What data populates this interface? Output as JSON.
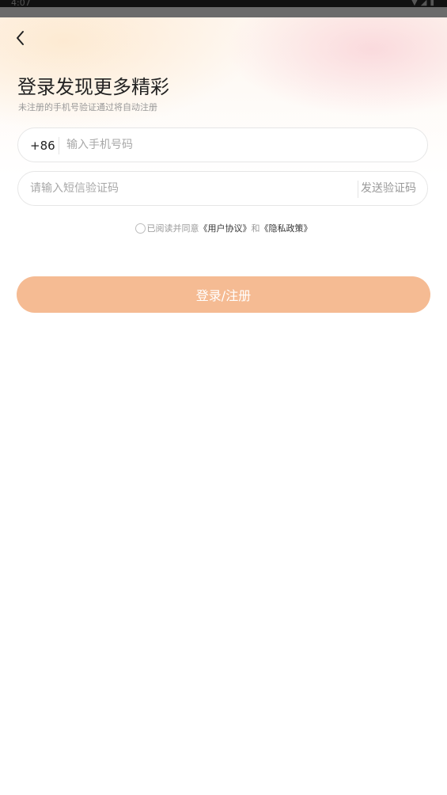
{
  "status_bar": {
    "time": "4:07",
    "icons": [
      "wifi-icon",
      "signal-icon",
      "battery-icon"
    ]
  },
  "header": {
    "back_icon": "chevron-left-icon"
  },
  "login": {
    "title": "登录发现更多精彩",
    "subtitle": "未注册的手机号验证通过将自动注册",
    "phone": {
      "country_code": "+86",
      "placeholder": "输入手机号码",
      "value": ""
    },
    "sms_code": {
      "placeholder": "请输入短信验证码",
      "value": "",
      "send_label": "发送验证码"
    },
    "agreement": {
      "checked": false,
      "prefix": "已阅读并同意",
      "user_agreement": "《用户协议》",
      "conjunction": "和",
      "privacy_policy": "《隐私政策》"
    },
    "submit_label": "登录/注册"
  },
  "colors": {
    "accent": "#f5bb93",
    "text_primary": "#222222",
    "text_secondary": "#999999",
    "border": "#e6e6e6"
  }
}
